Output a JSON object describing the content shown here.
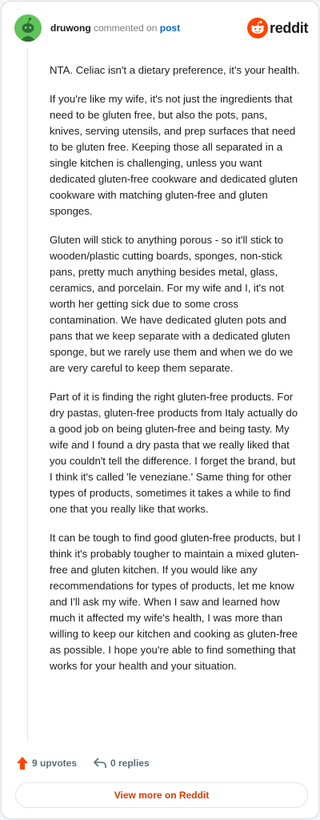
{
  "header": {
    "username": "druwong",
    "action_text": "commented on",
    "post_link": "post",
    "brand": "reddit"
  },
  "comment": {
    "paragraphs": [
      "NTA. Celiac isn't a dietary preference, it's your health.",
      "If you're like my wife, it's not just the ingredients that need to be gluten free, but also the pots, pans, knives, serving utensils, and prep surfaces that need to be gluten free. Keeping those all separated in a single kitchen is challenging, unless you want dedicated gluten-free cookware and dedicated gluten cookware with matching gluten-free and gluten sponges.",
      "Gluten will stick to anything porous - so it'll stick to wooden/plastic cutting boards, sponges, non-stick pans, pretty much anything besides metal, glass, ceramics, and porcelain. For my wife and I, it's not worth her getting sick due to some cross contamination. We have dedicated gluten pots and pans that we keep separate with a dedicated gluten sponge, but we rarely use them and when we do we are very careful to keep them separate.",
      "Part of it is finding the right gluten-free products. For dry pastas, gluten-free products from Italy actually do a good job on being gluten-free and being tasty. My wife and I found a dry pasta that we really liked that you couldn't tell the difference. I forget the brand, but I think it's called 'le veneziane.' Same thing for other types of products, sometimes it takes a while to find one that you really like that works.",
      "It can be tough to find good gluten-free products, but I think it's probably tougher to maintain a mixed gluten-free and gluten kitchen. If you would like any recommendations for types of products, let me know and I'll ask my wife. When I saw and learned how much it affected my wife's health, I was more than willing to keep our kitchen and cooking as gluten-free as possible. I hope you're able to find something that works for your health and your situation."
    ]
  },
  "actions": {
    "upvotes": "9 upvotes",
    "replies": "0 replies"
  },
  "footer": {
    "view_more": "View more on Reddit"
  },
  "colors": {
    "upvote": "#ff4500",
    "link": "#0a66c2",
    "view_more": "#d93a00"
  },
  "icons": {
    "avatar": "snoo-avatar",
    "logo": "reddit-logo-icon",
    "upvote": "upvote-arrow-icon",
    "reply": "reply-arrow-icon"
  }
}
